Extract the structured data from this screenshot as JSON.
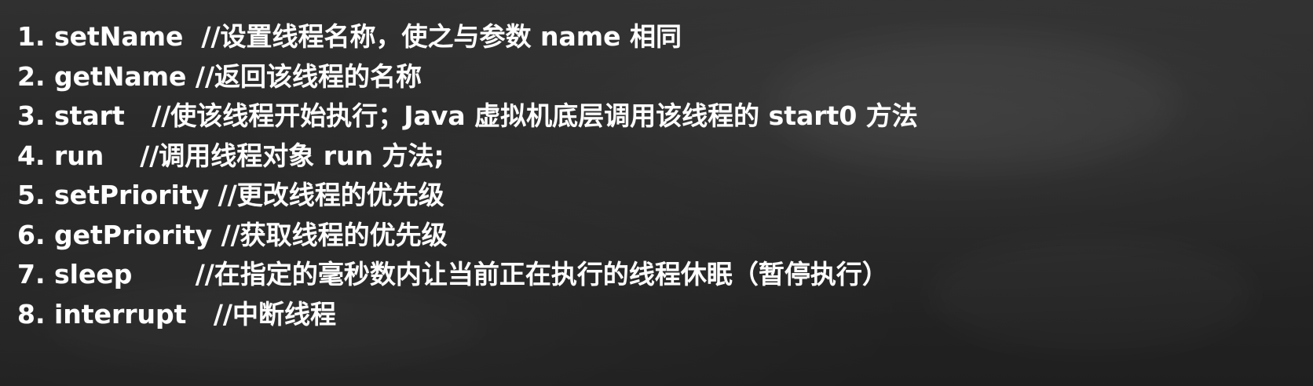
{
  "lines": [
    "1. setName  //设置线程名称，使之与参数 name 相同",
    "2. getName //返回该线程的名称",
    "3. start   //使该线程开始执行；Java 虚拟机底层调用该线程的 start0 方法",
    "4. run    //调用线程对象 run 方法;",
    "5. setPriority //更改线程的优先级",
    "6. getPriority //获取线程的优先级",
    "7. sleep       //在指定的毫秒数内让当前正在执行的线程休眠（暂停执行）",
    "8. interrupt   //中断线程"
  ]
}
